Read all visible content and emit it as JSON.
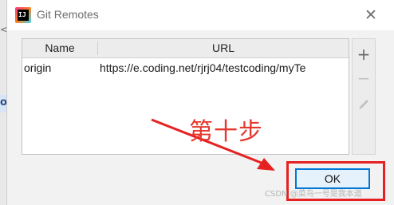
{
  "background": {
    "partial_text": "o",
    "chevron": "<"
  },
  "dialog": {
    "title": "Git Remotes",
    "app_icon_text": "IJ",
    "close_glyph": "✕",
    "table": {
      "columns": [
        "Name",
        "URL"
      ],
      "rows": [
        {
          "name": "origin",
          "url": "https://e.coding.net/rjrj04/testcoding/myTe"
        }
      ]
    },
    "toolbar": {
      "add_icon": "plus-icon",
      "remove_icon": "minus-icon",
      "edit_icon": "pencil-icon",
      "add_glyph": "+",
      "remove_glyph": "−"
    },
    "ok_label": "OK"
  },
  "annotation": {
    "text": "第十步",
    "color": "#e6392d"
  },
  "watermark": "CSDN @菜鸟一号是我本道",
  "colors": {
    "accent": "#0078d7",
    "highlight": "#e62121"
  }
}
